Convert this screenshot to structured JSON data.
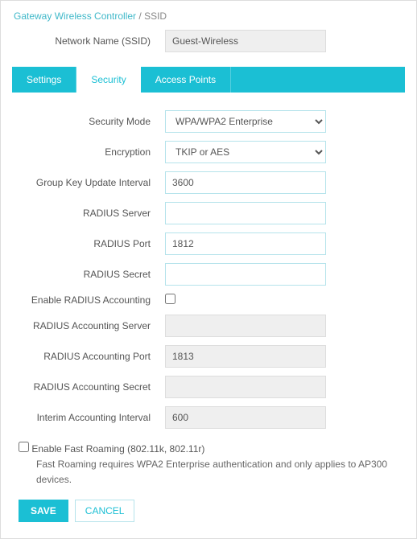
{
  "breadcrumb": {
    "parent": "Gateway Wireless Controller",
    "sep": " / ",
    "current": "SSID"
  },
  "ssid": {
    "label": "Network Name (SSID)",
    "value": "Guest-Wireless"
  },
  "tabs": {
    "settings": "Settings",
    "security": "Security",
    "access_points": "Access Points"
  },
  "fields": {
    "security_mode": {
      "label": "Security Mode",
      "value": "WPA/WPA2 Enterprise"
    },
    "encryption": {
      "label": "Encryption",
      "value": "TKIP or AES"
    },
    "group_key_update": {
      "label": "Group Key Update Interval",
      "value": "3600"
    },
    "radius_server": {
      "label": "RADIUS Server",
      "value": ""
    },
    "radius_port": {
      "label": "RADIUS Port",
      "value": "1812"
    },
    "radius_secret": {
      "label": "RADIUS Secret",
      "value": ""
    },
    "enable_radius_acct": {
      "label": "Enable RADIUS Accounting",
      "checked": false
    },
    "radius_acct_server": {
      "label": "RADIUS Accounting Server",
      "value": ""
    },
    "radius_acct_port": {
      "label": "RADIUS Accounting Port",
      "value": "1813"
    },
    "radius_acct_secret": {
      "label": "RADIUS Accounting Secret",
      "value": ""
    },
    "interim_acct_interval": {
      "label": "Interim Accounting Interval",
      "value": "600"
    }
  },
  "fast_roaming": {
    "checked": false,
    "label": "Enable Fast Roaming (802.11k, 802.11r)",
    "note": "Fast Roaming requires WPA2 Enterprise authentication and only applies to AP300 devices."
  },
  "actions": {
    "save": "SAVE",
    "cancel": "CANCEL"
  }
}
